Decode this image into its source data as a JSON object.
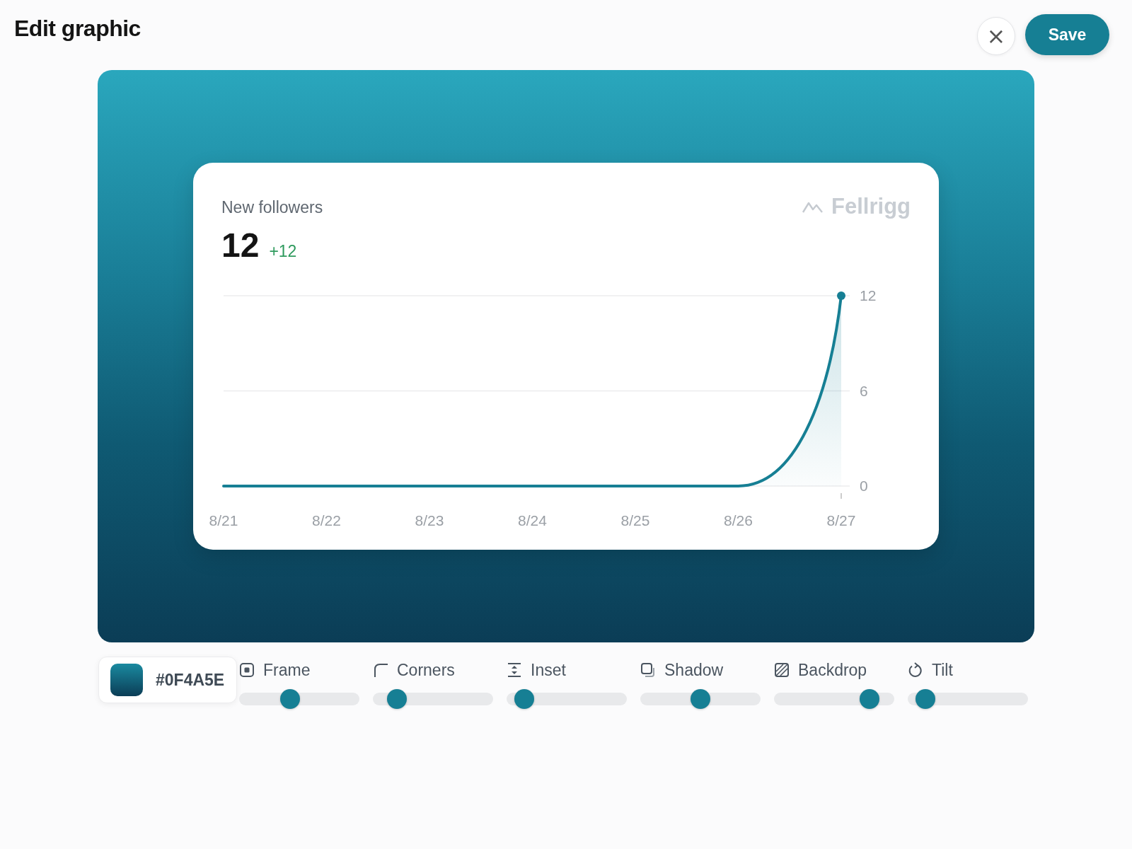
{
  "title": "Edit graphic",
  "actions": {
    "close": "×",
    "save": "Save"
  },
  "card": {
    "label": "New followers",
    "value": "12",
    "delta": "+12",
    "brand": "Fellrigg",
    "chart_data": {
      "type": "line",
      "categories": [
        "8/21",
        "8/22",
        "8/23",
        "8/24",
        "8/25",
        "8/26",
        "8/27"
      ],
      "series": [
        {
          "color": "#167f94",
          "values": [
            0,
            0,
            0,
            0,
            0,
            0,
            12
          ]
        }
      ],
      "ylim": [
        0,
        12
      ],
      "yticks": [
        0,
        6,
        12
      ]
    }
  },
  "color_field": {
    "value": "#0F4A5E"
  },
  "controls": [
    {
      "label": "Frame",
      "level": 0.41
    },
    {
      "label": "Corners",
      "level": 0.14
    },
    {
      "label": "Inset",
      "level": 0.08
    },
    {
      "label": "Shadow",
      "level": 0.5
    },
    {
      "label": "Backdrop",
      "level": 0.85
    },
    {
      "label": "Tilt",
      "level": 0.08
    }
  ]
}
